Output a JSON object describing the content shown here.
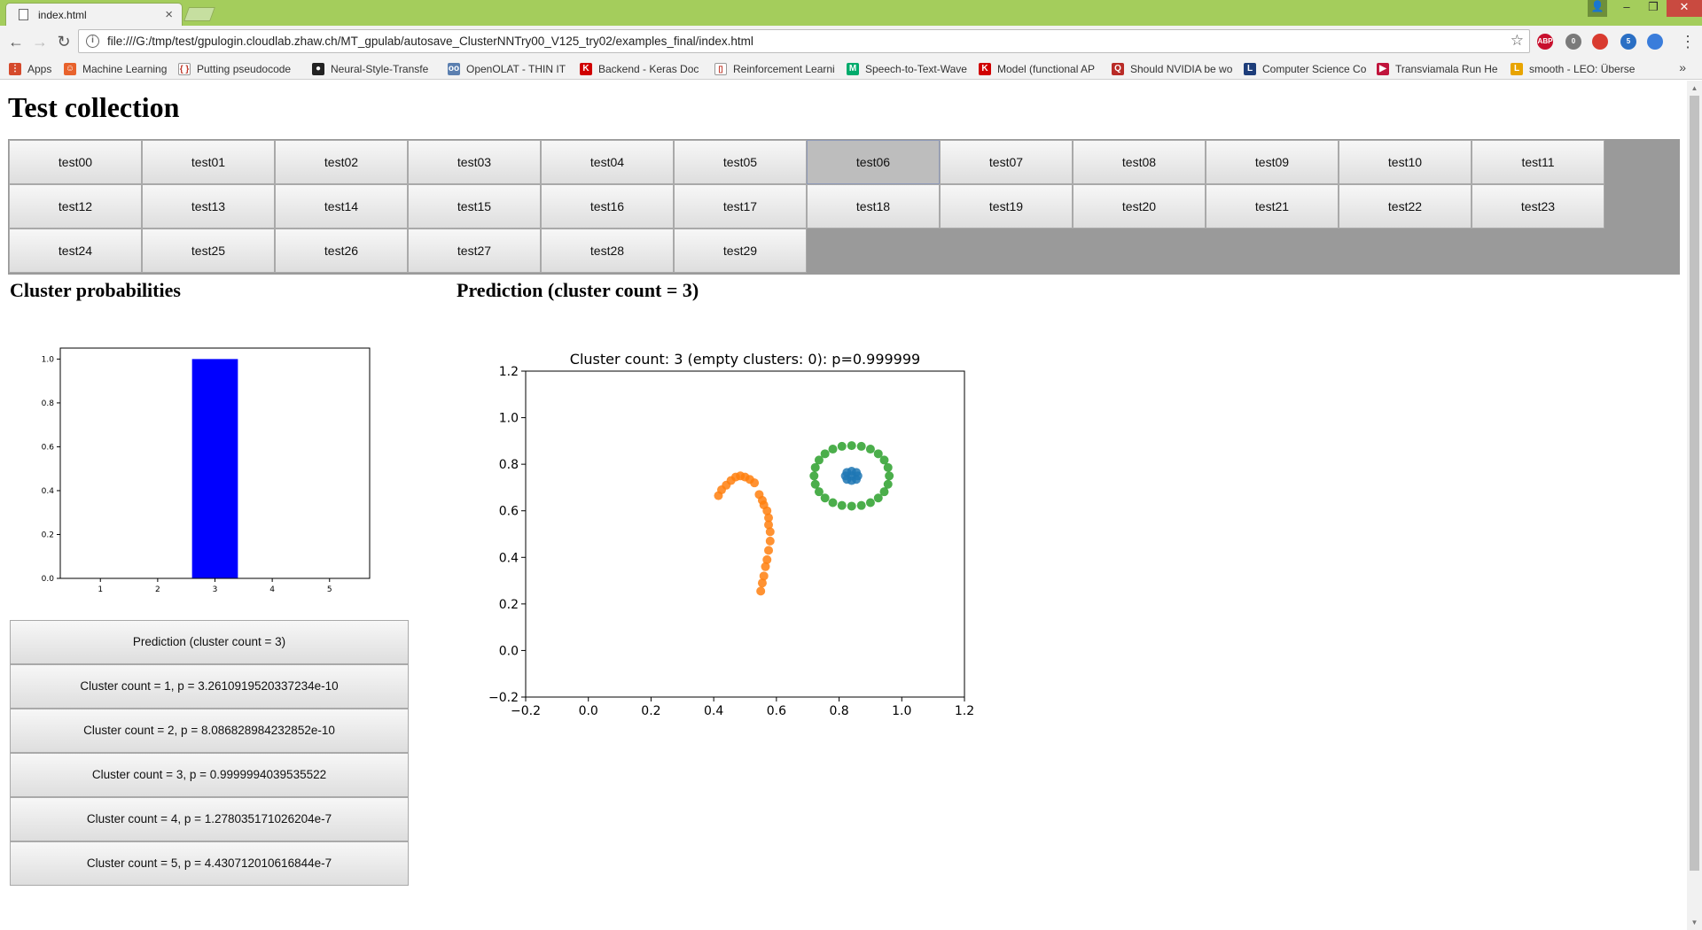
{
  "browser": {
    "tab_title": "index.html",
    "tab_close": "×",
    "url": "file:///G:/tmp/test/gpulogin.cloudlab.zhaw.ch/MT_gpulab/autosave_ClusterNNTry00_V125_try02/examples_final/index.html",
    "info_icon": "i",
    "star_icon": "☆",
    "nav": {
      "back": "←",
      "forward": "→",
      "reload": "↻"
    },
    "window_controls": {
      "user": "👤",
      "minimize": "–",
      "restore": "❐",
      "close": "✕"
    },
    "extensions": [
      {
        "label": "ABP",
        "color": "#c8102e"
      },
      {
        "label": "0",
        "color": "#7a7a7a"
      },
      {
        "label": "",
        "color": "#d93b2f"
      },
      {
        "label": "5",
        "color": "#2a6fc4"
      },
      {
        "label": "",
        "color": "#3a7ddb"
      }
    ],
    "menu_icon": "⋮"
  },
  "bookmarks": {
    "more": "»",
    "items": [
      {
        "label": "Apps",
        "icon": "apps-grid-icon",
        "color": "#d54a2c",
        "glyph": "⋮"
      },
      {
        "label": "Machine Learning",
        "icon": "folder-orange-icon",
        "color": "#e8622c",
        "glyph": "☺"
      },
      {
        "label": "Putting pseudocode",
        "icon": "braces-icon",
        "color": "#ffffff",
        "glyph": "{ }"
      },
      {
        "label": "Neural-Style-Transfe",
        "icon": "github-icon",
        "color": "#222222",
        "glyph": "●"
      },
      {
        "label": "OpenOLAT - THIN IT",
        "icon": "olat-icon",
        "color": "#5b7fb0",
        "glyph": "oo"
      },
      {
        "label": "Backend - Keras Doc",
        "icon": "keras-icon",
        "color": "#d00000",
        "glyph": "K"
      },
      {
        "label": "Reinforcement Learni",
        "icon": "page-icon",
        "color": "#ffffff",
        "glyph": "▯"
      },
      {
        "label": "Speech-to-Text-Wave",
        "icon": "medium-icon",
        "color": "#00ab6c",
        "glyph": "M"
      },
      {
        "label": "Model (functional AP",
        "icon": "keras-icon",
        "color": "#d00000",
        "glyph": "K"
      },
      {
        "label": "Should NVIDIA be wo",
        "icon": "quora-icon",
        "color": "#b92b27",
        "glyph": "Q"
      },
      {
        "label": "Computer Science Co",
        "icon": "lpn-icon",
        "color": "#1d3d7a",
        "glyph": "L"
      },
      {
        "label": "Transviamala Run He",
        "icon": "run-icon",
        "color": "#c0143c",
        "glyph": "▶"
      },
      {
        "label": "smooth - LEO: Überse",
        "icon": "leo-icon",
        "color": "#e8a400",
        "glyph": "L"
      }
    ]
  },
  "page": {
    "title": "Test collection",
    "active_test": "test06",
    "tests": [
      "test00",
      "test01",
      "test02",
      "test03",
      "test04",
      "test05",
      "test06",
      "test07",
      "test08",
      "test09",
      "test10",
      "test11",
      "test12",
      "test13",
      "test14",
      "test15",
      "test16",
      "test17",
      "test18",
      "test19",
      "test20",
      "test21",
      "test22",
      "test23",
      "test24",
      "test25",
      "test26",
      "test27",
      "test28",
      "test29"
    ],
    "cluster_probabilities_heading": "Cluster probabilities",
    "prediction_heading": "Prediction (cluster count = 3)",
    "probability_buttons": [
      "Prediction (cluster count = 3)",
      "Cluster count = 1, p = 3.2610919520337234e-10",
      "Cluster count = 2, p = 8.086828984232852e-10",
      "Cluster count = 3, p = 0.9999994039535522",
      "Cluster count = 4, p = 1.278035171026204e-7",
      "Cluster count = 5, p = 4.430712010616844e-7"
    ]
  },
  "chart_data": [
    {
      "type": "bar",
      "categories": [
        "1",
        "2",
        "3",
        "4",
        "5"
      ],
      "values": [
        3.2610919520337234e-10,
        8.086828984232852e-10,
        0.9999994039535522,
        1.278035171026204e-07,
        4.430712010616844e-07
      ],
      "xlim": [
        0.3,
        5.7
      ],
      "ylim": [
        0,
        1.05
      ],
      "yticks": [
        "0.0",
        "0.2",
        "0.4",
        "0.6",
        "0.8",
        "1.0"
      ],
      "color": "#0000ff",
      "grid": false
    },
    {
      "type": "scatter",
      "title": "Cluster count: 3 (empty clusters: 0): p=0.999999",
      "xlim": [
        -0.2,
        1.2
      ],
      "ylim": [
        -0.2,
        1.2
      ],
      "xticks": [
        "−0.2",
        "0.0",
        "0.2",
        "0.4",
        "0.6",
        "0.8",
        "1.0",
        "1.2"
      ],
      "yticks": [
        "−0.2",
        "0.0",
        "0.2",
        "0.4",
        "0.6",
        "0.8",
        "1.0",
        "1.2"
      ],
      "grid": false,
      "series": [
        {
          "color": "#1f77b4",
          "points": [
            [
              0.84,
              0.77
            ],
            [
              0.855,
              0.765
            ],
            [
              0.86,
              0.75
            ],
            [
              0.855,
              0.735
            ],
            [
              0.84,
              0.73
            ],
            [
              0.825,
              0.735
            ],
            [
              0.82,
              0.75
            ],
            [
              0.825,
              0.765
            ],
            [
              0.84,
              0.75
            ]
          ]
        },
        {
          "color": "#ff7f0e",
          "points": [
            [
              0.415,
              0.665
            ],
            [
              0.425,
              0.69
            ],
            [
              0.44,
              0.71
            ],
            [
              0.455,
              0.73
            ],
            [
              0.47,
              0.745
            ],
            [
              0.485,
              0.75
            ],
            [
              0.5,
              0.745
            ],
            [
              0.515,
              0.735
            ],
            [
              0.53,
              0.72
            ],
            [
              0.545,
              0.67
            ],
            [
              0.555,
              0.645
            ],
            [
              0.56,
              0.625
            ],
            [
              0.57,
              0.6
            ],
            [
              0.575,
              0.57
            ],
            [
              0.575,
              0.54
            ],
            [
              0.58,
              0.51
            ],
            [
              0.58,
              0.47
            ],
            [
              0.575,
              0.43
            ],
            [
              0.57,
              0.39
            ],
            [
              0.565,
              0.36
            ],
            [
              0.56,
              0.32
            ],
            [
              0.555,
              0.29
            ],
            [
              0.55,
              0.255
            ]
          ]
        },
        {
          "color": "#2ca02c",
          "points": [
            [
              0.96,
              0.75
            ],
            [
              0.956,
              0.786
            ],
            [
              0.944,
              0.818
            ],
            [
              0.925,
              0.845
            ],
            [
              0.9,
              0.865
            ],
            [
              0.871,
              0.877
            ],
            [
              0.84,
              0.88
            ],
            [
              0.809,
              0.877
            ],
            [
              0.78,
              0.865
            ],
            [
              0.755,
              0.845
            ],
            [
              0.736,
              0.818
            ],
            [
              0.724,
              0.786
            ],
            [
              0.72,
              0.75
            ],
            [
              0.724,
              0.714
            ],
            [
              0.736,
              0.682
            ],
            [
              0.755,
              0.655
            ],
            [
              0.78,
              0.635
            ],
            [
              0.809,
              0.623
            ],
            [
              0.84,
              0.62
            ],
            [
              0.871,
              0.623
            ],
            [
              0.9,
              0.635
            ],
            [
              0.925,
              0.655
            ],
            [
              0.944,
              0.682
            ],
            [
              0.956,
              0.714
            ]
          ]
        }
      ]
    }
  ]
}
